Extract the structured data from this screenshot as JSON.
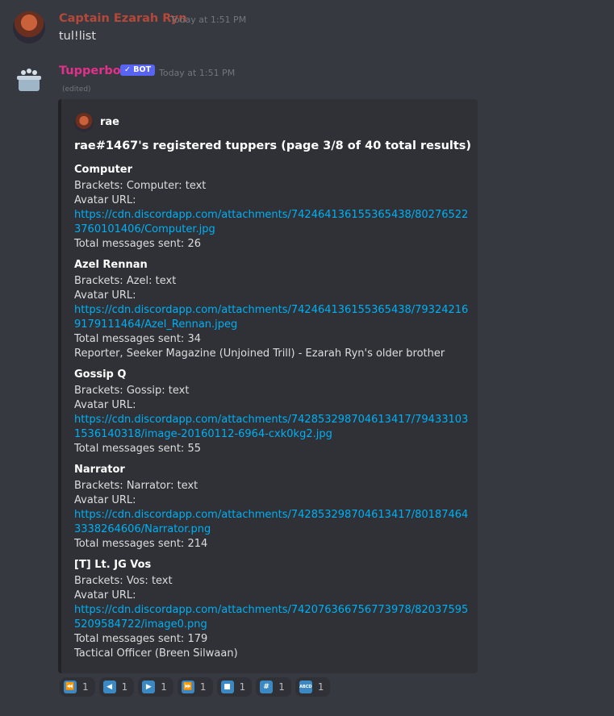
{
  "messages": [
    {
      "username": "Captain Ezarah Ryn",
      "timestamp": "Today at 1:51 PM",
      "content": "tul!list"
    },
    {
      "username": "Tupperbox",
      "bot_badge": "✓ BOT",
      "timestamp": "Today at 1:51 PM",
      "edited": "(edited)"
    }
  ],
  "embed": {
    "author": "rae",
    "title": "rae#1467's registered tuppers (page 3/8 of 40 total results)",
    "fields": [
      {
        "name": "Computer",
        "brackets": "Brackets: Computer: text",
        "avatar_label": "Avatar URL:",
        "url": "https://cdn.discordapp.com/attachments/742464136155365438/802765223760101406/Computer.jpg",
        "total": "Total messages sent: 26",
        "desc": ""
      },
      {
        "name": "Azel Rennan",
        "brackets": "Brackets: Azel: text",
        "avatar_label": "Avatar URL:",
        "url": "https://cdn.discordapp.com/attachments/742464136155365438/793242169179111464/Azel_Rennan.jpeg",
        "total": "Total messages sent: 34",
        "desc": "Reporter, Seeker Magazine (Unjoined Trill) - Ezarah Ryn's older brother"
      },
      {
        "name": "Gossip Q",
        "brackets": "Brackets: Gossip: text",
        "avatar_label": "Avatar URL:",
        "url": "https://cdn.discordapp.com/attachments/742853298704613417/794331031536140318/image-20160112-6964-cxk0kg2.jpg",
        "total": "Total messages sent: 55",
        "desc": ""
      },
      {
        "name": "Narrator",
        "brackets": "Brackets: Narrator: text",
        "avatar_label": "Avatar URL:",
        "url": "https://cdn.discordapp.com/attachments/742853298704613417/801874643338264606/Narrator.png",
        "total": "Total messages sent: 214",
        "desc": ""
      },
      {
        "name": "[T] Lt. JG Vos",
        "brackets": "Brackets: Vos: text",
        "avatar_label": "Avatar URL:",
        "url": "https://cdn.discordapp.com/attachments/742076366756773978/820375955209584722/image0.png",
        "total": "Total messages sent: 179",
        "desc": "Tactical Officer (Breen Silwaan)"
      }
    ]
  },
  "reactions": [
    {
      "icon": "first-page-icon",
      "glyph": "⏪",
      "count": "1"
    },
    {
      "icon": "previous-page-icon",
      "glyph": "◀",
      "count": "1"
    },
    {
      "icon": "next-page-icon",
      "glyph": "▶",
      "count": "1"
    },
    {
      "icon": "last-page-icon",
      "glyph": "⏩",
      "count": "1"
    },
    {
      "icon": "stop-icon",
      "glyph": "■",
      "count": "1"
    },
    {
      "icon": "number-sign-icon",
      "glyph": "#",
      "count": "1"
    },
    {
      "icon": "abcd-icon",
      "glyph": "ABCD",
      "count": "1"
    }
  ],
  "colors": {
    "background": "#36393f",
    "embed_bg": "#2f3136",
    "user1": "#b4483a",
    "bot_name": "#e2308b",
    "link": "#00b0f4",
    "badge": "#5865f2"
  }
}
